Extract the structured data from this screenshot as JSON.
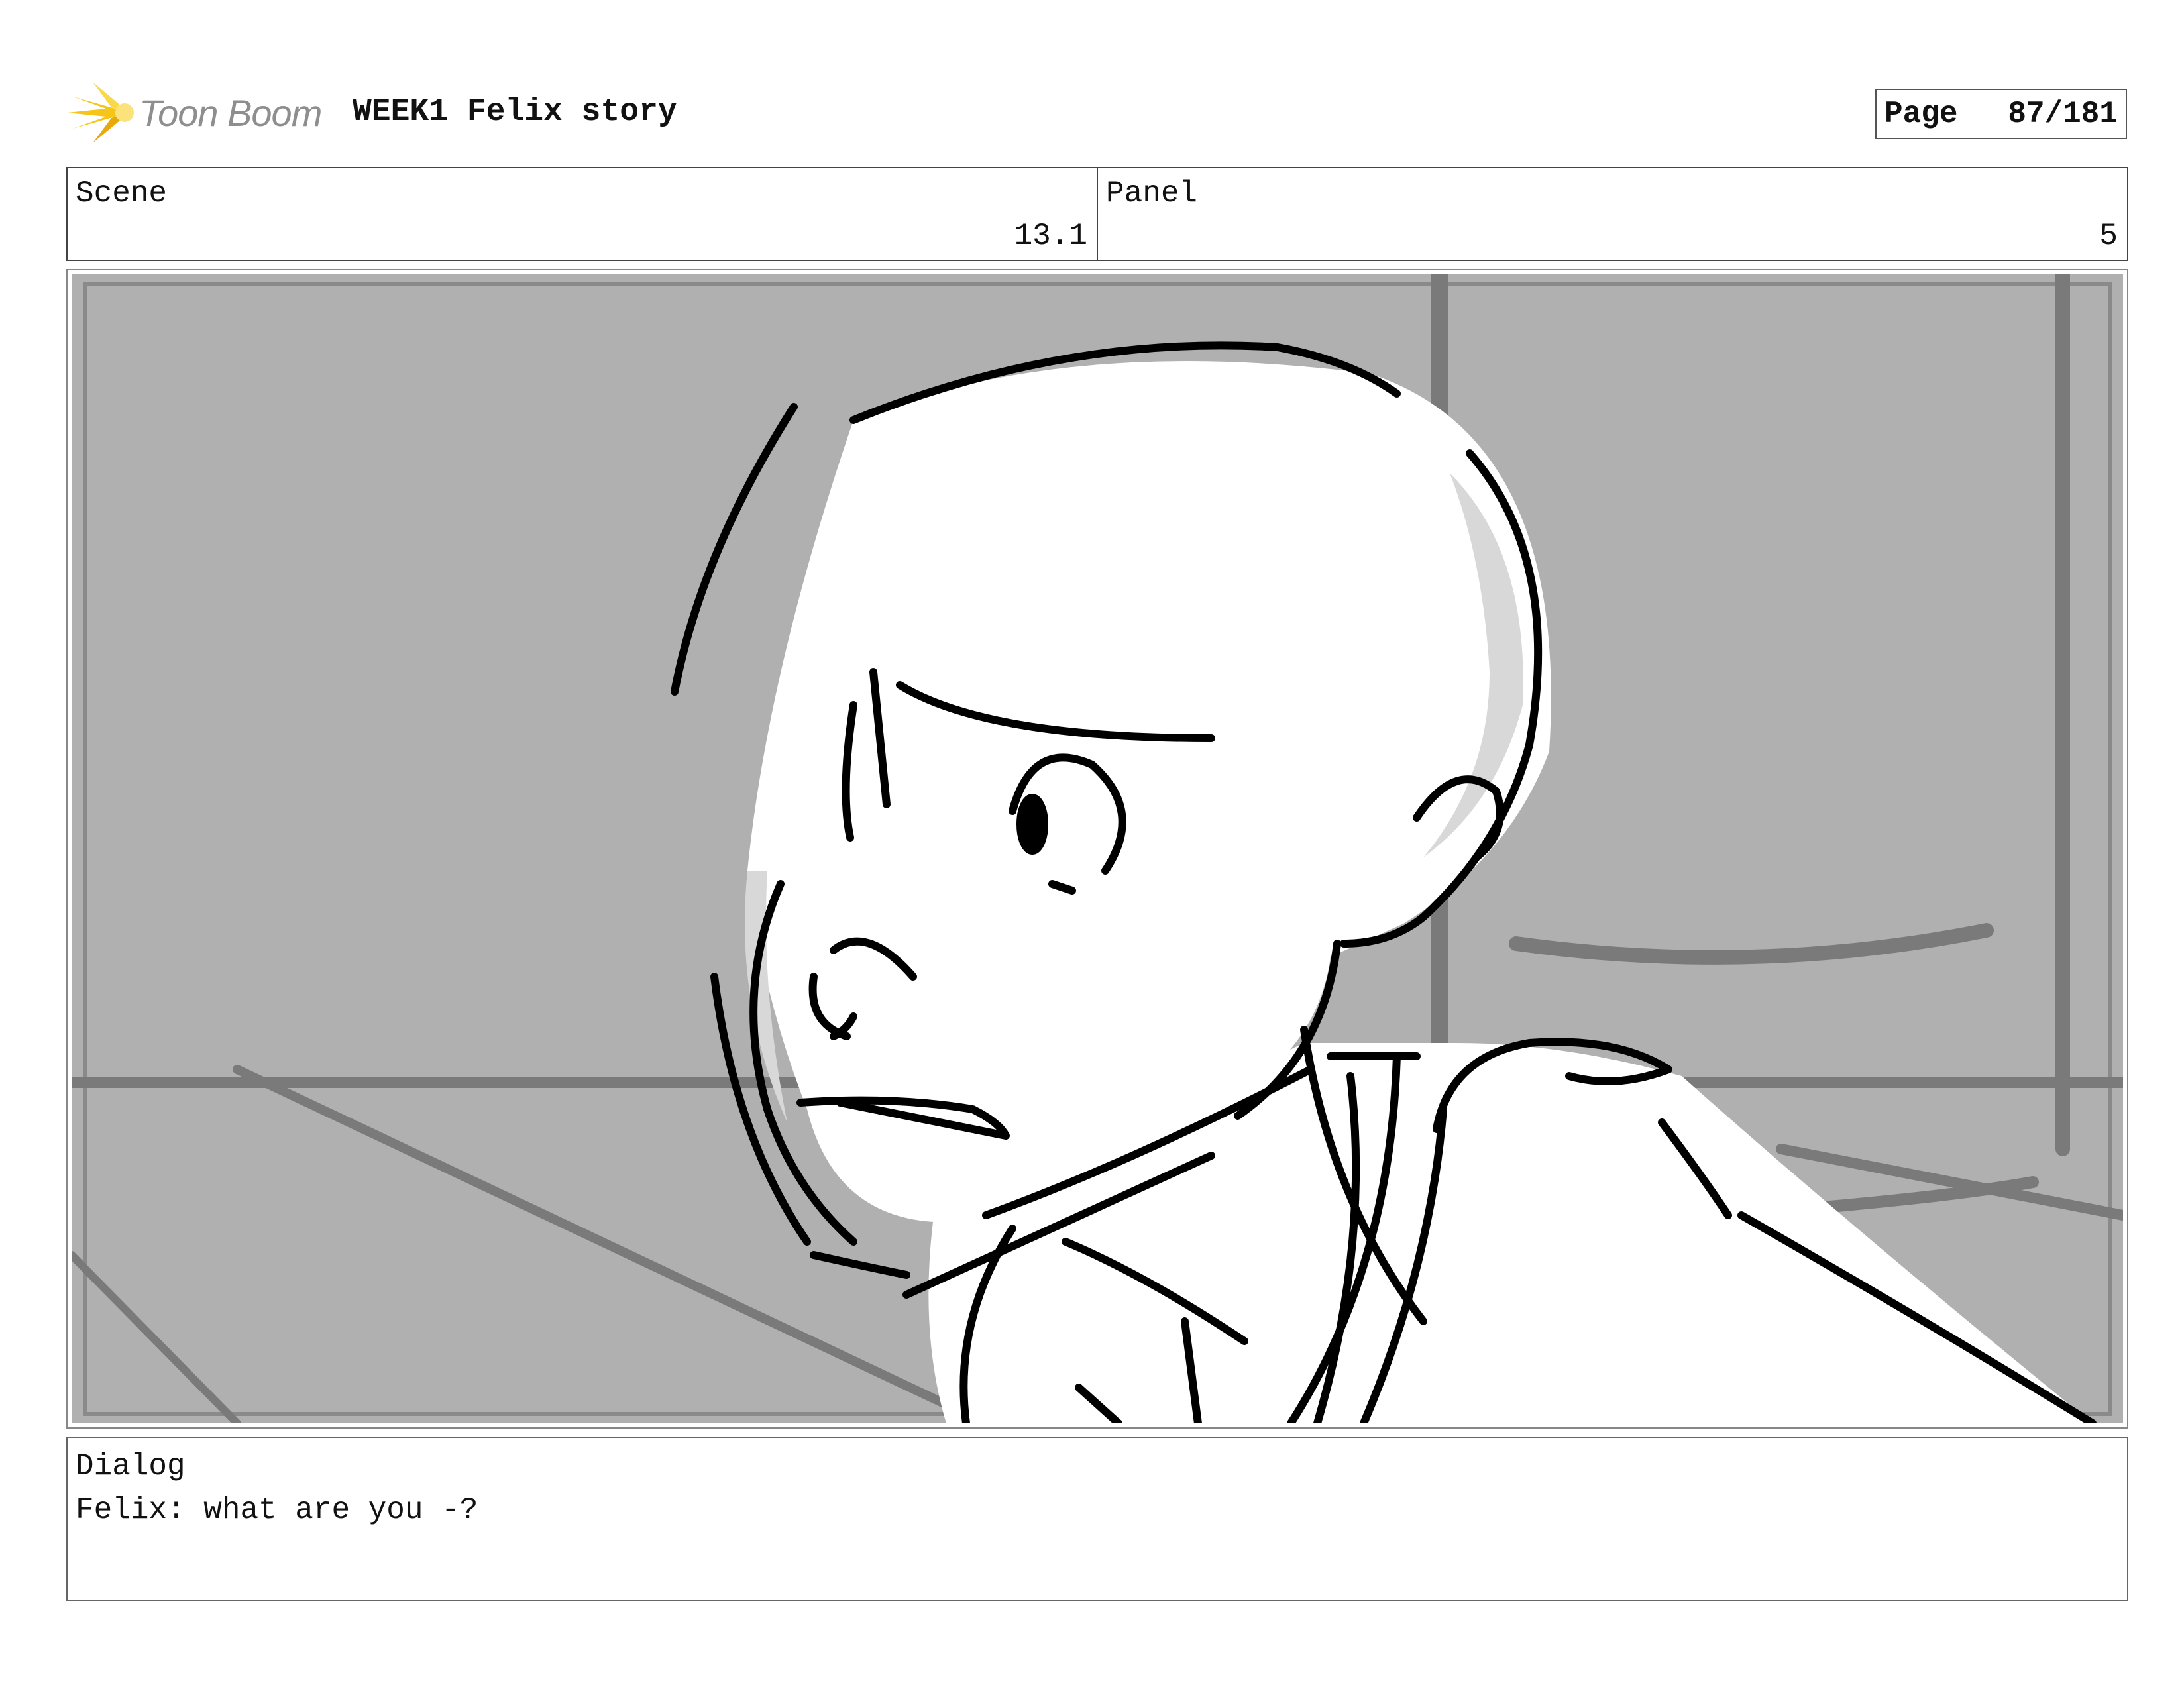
{
  "header": {
    "logo_text": "Toon Boom",
    "project_title": "WEEK1 Felix story",
    "page_label": "Page",
    "page_value": "87/181"
  },
  "info": {
    "scene_label": "Scene",
    "scene_value": "13.1",
    "panel_label": "Panel",
    "panel_value": "5"
  },
  "dialog": {
    "label": "Dialog",
    "text": "Felix: what are you -?"
  },
  "colors": {
    "logo_star": "#f5c518",
    "logo_text": "#8e8e8e",
    "panel_background": "#b0b0b0",
    "sketch_gray": "#7a7a7a",
    "sketch_line": "#000000"
  }
}
